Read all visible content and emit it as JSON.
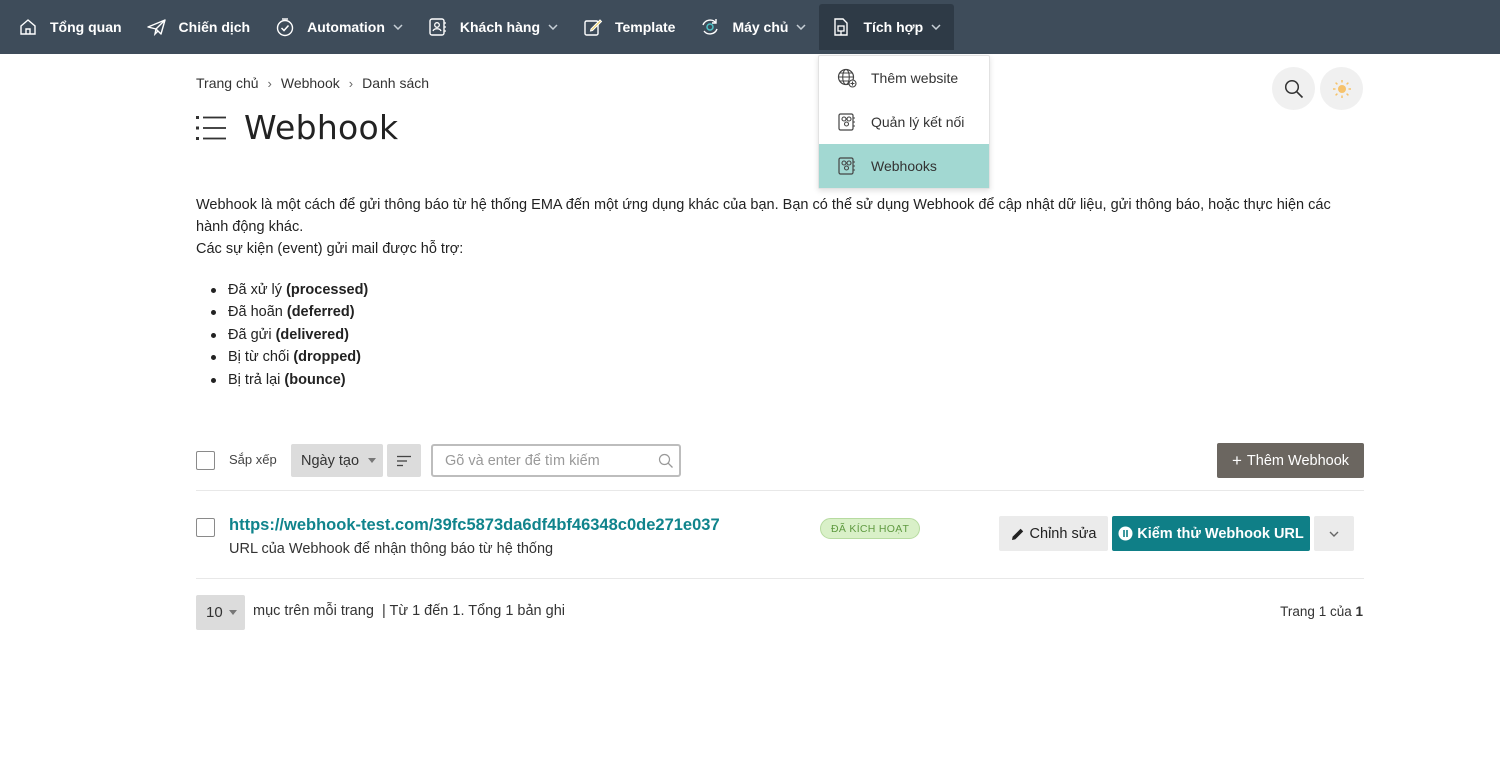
{
  "nav": {
    "items": [
      {
        "label": "Tổng quan",
        "icon": "home-icon"
      },
      {
        "label": "Chiến dịch",
        "icon": "paper-plane-icon"
      },
      {
        "label": "Automation",
        "icon": "clock-check-icon"
      },
      {
        "label": "Khách hàng",
        "icon": "contacts-icon"
      },
      {
        "label": "Template",
        "icon": "edit-document-icon"
      },
      {
        "label": "Máy chủ",
        "icon": "server-sync-icon"
      },
      {
        "label": "Tích hợp",
        "icon": "integration-icon"
      }
    ],
    "active": "Tích hợp"
  },
  "dropdown": {
    "items": [
      {
        "label": "Thêm website",
        "icon": "globe-plus-icon"
      },
      {
        "label": "Quản lý kết nối",
        "icon": "connection-icon"
      },
      {
        "label": "Webhooks",
        "icon": "webhook-icon"
      }
    ],
    "selected": "Webhooks"
  },
  "breadcrumb": {
    "home": "Trang chủ",
    "section": "Webhook",
    "current": "Danh sách",
    "separator": "›"
  },
  "page": {
    "title": "Webhook"
  },
  "description": {
    "line1": "Webhook là một cách để gửi thông báo từ hệ thống EMA đến một ứng dụng khác của bạn. Bạn có thể sử dụng Webhook để cập nhật dữ liệu, gửi thông báo, hoặc thực hiện các hành động khác.",
    "line2": "Các sự kiện (event) gửi mail được hỗ trợ:"
  },
  "events": [
    {
      "label": "Đã xử lý",
      "code": "(processed)"
    },
    {
      "label": "Đã hoãn",
      "code": "(deferred)"
    },
    {
      "label": "Đã gửi",
      "code": "(delivered)"
    },
    {
      "label": "Bị từ chối",
      "code": "(dropped)"
    },
    {
      "label": "Bị trả lại",
      "code": "(bounce)"
    }
  ],
  "toolbar": {
    "sort_label": "Sắp xếp",
    "sort_value": "Ngày tạo",
    "search_placeholder": "Gõ và enter để tìm kiếm",
    "add_label": "Thêm Webhook"
  },
  "webhooks": [
    {
      "url": "https://webhook-test.com/39fc5873da6df4bf46348c0de271e037",
      "description": "URL của Webhook để nhận thông báo từ hệ thống",
      "status": "ĐÃ KÍCH HOẠT",
      "edit_label": "Chỉnh sửa",
      "test_label": "Kiểm thử Webhook URL"
    }
  ],
  "pagination": {
    "per_page": "10",
    "per_page_label": "mục trên mỗi trang",
    "summary": "| Từ 1 đến 1. Tổng 1 bản ghi",
    "page_prefix": "Trang 1 của",
    "total_pages": "1"
  },
  "colors": {
    "nav_bg": "#3e4c5a",
    "accent": "#0f7f87",
    "dropdown_selected": "#a2d8d2",
    "status_bg": "#d9f0c8",
    "add_button": "#6b6660"
  }
}
